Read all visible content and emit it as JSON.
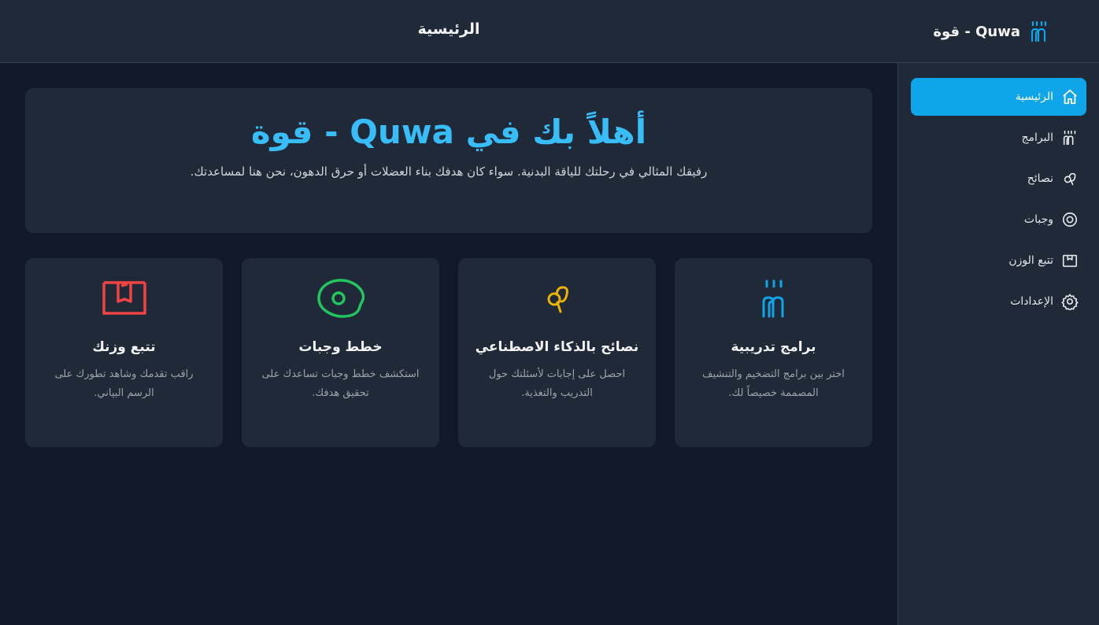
{
  "header": {
    "brand_name": "Quwa - قوة",
    "brand_icon": "dumbbell-icon",
    "page_title": "الرئيسية"
  },
  "sidebar": {
    "items": [
      {
        "label": "الرئيسية",
        "icon": "home-icon",
        "active": true
      },
      {
        "label": "البرامج",
        "icon": "dumbbell-icon",
        "active": false
      },
      {
        "label": "نصائح",
        "icon": "brain-icon",
        "active": false
      },
      {
        "label": "وجبات",
        "icon": "meal-icon",
        "active": false
      },
      {
        "label": "تتبع الوزن",
        "icon": "scale-icon",
        "active": false
      },
      {
        "label": "الإعدادات",
        "icon": "gear-icon",
        "active": false
      }
    ]
  },
  "hero": {
    "title": "أهلاً بك في Quwa - قوة",
    "subtitle": "رفيقك المثالي في رحلتك للياقة البدنية. سواء كان هدفك بناء العضلات أو حرق الدهون، نحن هنا لمساعدتك."
  },
  "cards": [
    {
      "title": "برامج تدريبية",
      "description": "اختر بين برامج التضخيم والتنشيف المصممة خصيصاً لك.",
      "icon": "dumbbell-icon",
      "color": "#0ea5e9"
    },
    {
      "title": "نصائح بالذكاء الاصطناعي",
      "description": "احصل على إجابات لأسئلتك حول التدريب والتغذية.",
      "icon": "brain-icon",
      "color": "#eab308"
    },
    {
      "title": "خطط وجبات",
      "description": "استكشف خطط وجبات تساعدك على تحقيق هدفك.",
      "icon": "egg-icon",
      "color": "#22c55e"
    },
    {
      "title": "تتبع وزنك",
      "description": "راقب تقدمك وشاهد تطورك على الرسم البياني.",
      "icon": "scale-icon",
      "color": "#ef4444"
    }
  ],
  "colors": {
    "accent": "#0ea5e9",
    "background": "#111827",
    "surface": "#1f2937",
    "hero_title": "#38bdf8"
  }
}
